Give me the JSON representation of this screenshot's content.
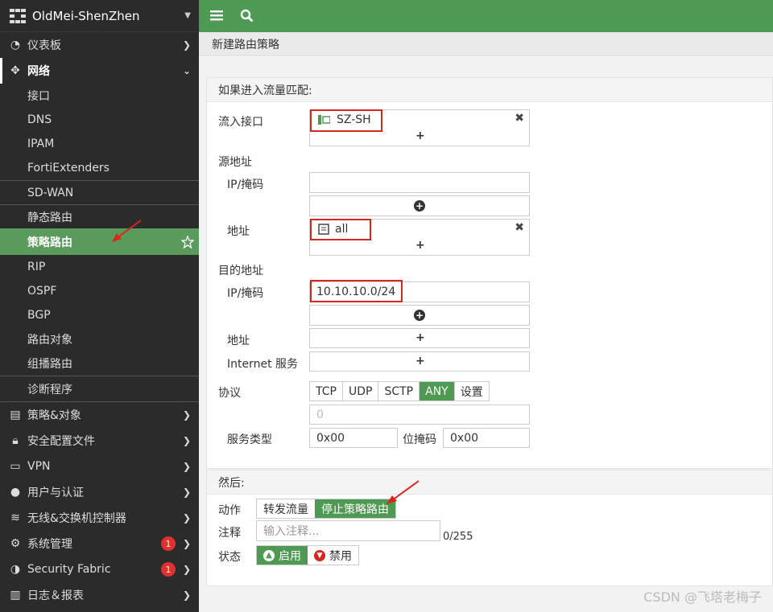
{
  "sidebar": {
    "device_name": "OldMei-ShenZhen",
    "items": [
      {
        "label": "仪表板",
        "icon": "dashboard-icon"
      },
      {
        "label": "网络",
        "icon": "network-icon"
      },
      {
        "label": "策略&对象",
        "icon": "policy-icon"
      },
      {
        "label": "安全配置文件",
        "icon": "lock-icon"
      },
      {
        "label": "VPN",
        "icon": "vpn-icon"
      },
      {
        "label": "用户与认证",
        "icon": "user-icon"
      },
      {
        "label": "无线&交换机控制器",
        "icon": "wifi-icon"
      },
      {
        "label": "系统管理",
        "icon": "gear-icon",
        "badge": "1"
      },
      {
        "label": "Security Fabric",
        "icon": "fabric-icon",
        "badge": "1"
      },
      {
        "label": "日志＆报表",
        "icon": "chart-icon"
      }
    ],
    "network_sub": [
      "接口",
      "DNS",
      "IPAM",
      "FortiExtenders",
      "SD-WAN",
      "静态路由",
      "策略路由",
      "RIP",
      "OSPF",
      "BGP",
      "路由对象",
      "组播路由",
      "诊断程序"
    ]
  },
  "page": {
    "title": "新建路由策略"
  },
  "match": {
    "section_label": "如果进入流量匹配:",
    "incoming_label": "流入接口",
    "incoming_value": "SZ-SH",
    "source_label": "源地址",
    "ipmask_label": "IP/掩码",
    "address_label": "地址",
    "address_value": "all",
    "dest_label": "目的地址",
    "dest_ipmask_value": "10.10.10.0/24",
    "internet_service_label": "Internet 服务",
    "protocol_label": "协议",
    "protocols": [
      "TCP",
      "UDP",
      "SCTP",
      "ANY",
      "设置"
    ],
    "protocol_number": "0",
    "tos_label": "服务类型",
    "tos_value": "0x00",
    "bitmask_label": "位掩码",
    "bitmask_value": "0x00"
  },
  "then": {
    "section_label": "然后:",
    "action_label": "动作",
    "actions": [
      "转发流量",
      "停止策略路由"
    ],
    "comment_label": "注释",
    "comment_placeholder": "输入注释...",
    "comment_count": "0/255",
    "status_label": "状态",
    "enable_label": "启用",
    "disable_label": "禁用"
  },
  "watermark": "CSDN @飞塔老梅子",
  "colors": {
    "accent": "#4e9a52",
    "highlight": "#d9261c",
    "sidebar_bg": "#2b2b2b"
  }
}
